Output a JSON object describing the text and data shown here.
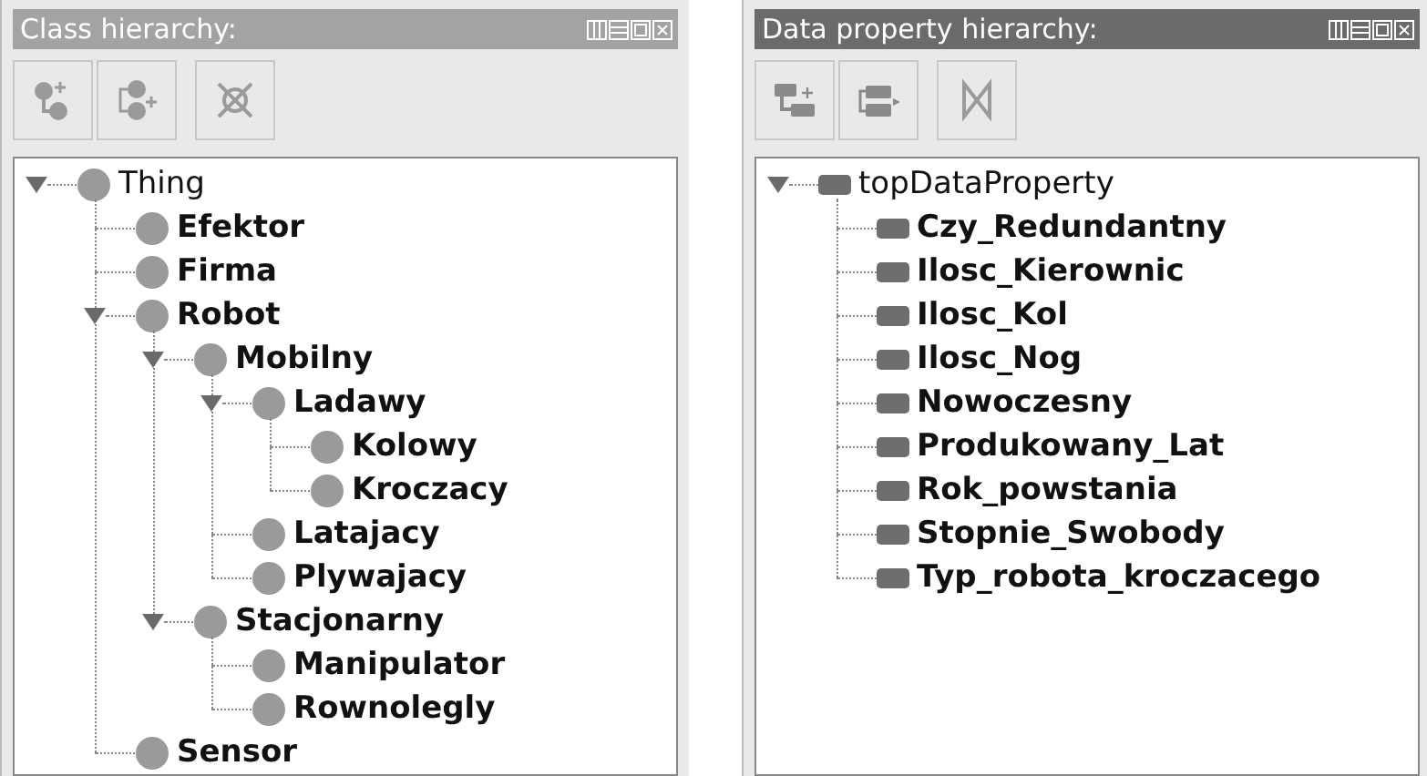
{
  "panels": [
    {
      "kind": "class",
      "title": "Class hierarchy:",
      "active": false,
      "tree": [
        {
          "label": "Thing",
          "expanded": true,
          "children": [
            {
              "label": "Efektor"
            },
            {
              "label": "Firma"
            },
            {
              "label": "Robot",
              "expanded": true,
              "children": [
                {
                  "label": "Mobilny",
                  "expanded": true,
                  "children": [
                    {
                      "label": "Ladawy",
                      "expanded": true,
                      "children": [
                        {
                          "label": "Kolowy"
                        },
                        {
                          "label": "Kroczacy"
                        }
                      ]
                    },
                    {
                      "label": "Latajacy"
                    },
                    {
                      "label": "Plywajacy"
                    }
                  ]
                },
                {
                  "label": "Stacjonarny",
                  "expanded": true,
                  "children": [
                    {
                      "label": "Manipulator"
                    },
                    {
                      "label": "Rownolegly"
                    }
                  ]
                }
              ]
            },
            {
              "label": "Sensor"
            }
          ]
        }
      ]
    },
    {
      "kind": "data_property",
      "title": "Data property hierarchy:",
      "active": true,
      "tree": [
        {
          "label": "topDataProperty",
          "expanded": true,
          "children": [
            {
              "label": "Czy_Redundantny"
            },
            {
              "label": "Ilosc_Kierownic"
            },
            {
              "label": "Ilosc_Kol"
            },
            {
              "label": "Ilosc_Nog"
            },
            {
              "label": "Nowoczesny"
            },
            {
              "label": "Produkowany_Lat"
            },
            {
              "label": "Rok_powstania"
            },
            {
              "label": "Stopnie_Swobody"
            },
            {
              "label": "Typ_robota_kroczacego"
            }
          ]
        }
      ]
    }
  ]
}
